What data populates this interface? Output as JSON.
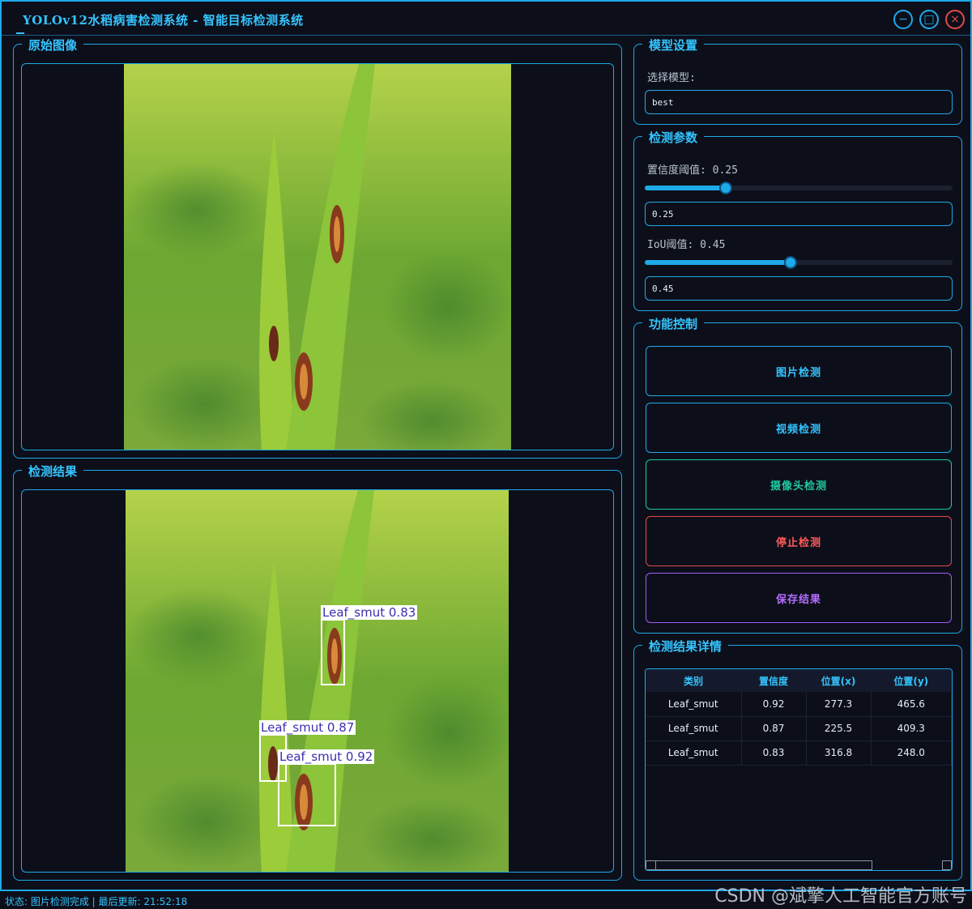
{
  "window": {
    "title": "YOLOv12水稻病害检测系统 - 智能目标检测系统"
  },
  "window_buttons": {
    "minimize": "−",
    "maximize": "□",
    "close": "×"
  },
  "panels": {
    "original": {
      "title": "原始图像"
    },
    "result": {
      "title": "检测结果"
    }
  },
  "model": {
    "title": "模型设置",
    "select_label": "选择模型:",
    "selected": "best"
  },
  "params": {
    "title": "检测参数",
    "conf_label": "置信度阈值: 0.25",
    "conf_value": "0.25",
    "conf_level": 0.25,
    "iou_label": "IoU阈值: 0.45",
    "iou_value": "0.45",
    "iou_level": 0.45
  },
  "controls": {
    "title": "功能控制",
    "image_detect": "图片检测",
    "video_detect": "视频检测",
    "camera_detect": "摄像头检测",
    "stop_detect": "停止检测",
    "save_result": "保存结果"
  },
  "details": {
    "title": "检测结果详情",
    "columns": [
      "类别",
      "置信度",
      "位置(x)",
      "位置(y)"
    ],
    "rows": [
      [
        "Leaf_smut",
        "0.92",
        "277.3",
        "465.6"
      ],
      [
        "Leaf_smut",
        "0.87",
        "225.5",
        "409.3"
      ],
      [
        "Leaf_smut",
        "0.83",
        "316.8",
        "248.0"
      ]
    ]
  },
  "detections": [
    {
      "label": "Leaf_smut 0.83"
    },
    {
      "label": "Leaf_smut 0.87"
    },
    {
      "label": "Leaf_smut 0.92"
    }
  ],
  "status": {
    "text": "状态: 图片检测完成 | 最后更新: 21:52:18"
  },
  "watermark": {
    "text": "CSDN @斌擎人工智能官方账号"
  },
  "colors": {
    "accent": "#1ea9e8",
    "camera": "#1fc9a0",
    "stop": "#e24a4a",
    "save": "#a25cf0"
  }
}
